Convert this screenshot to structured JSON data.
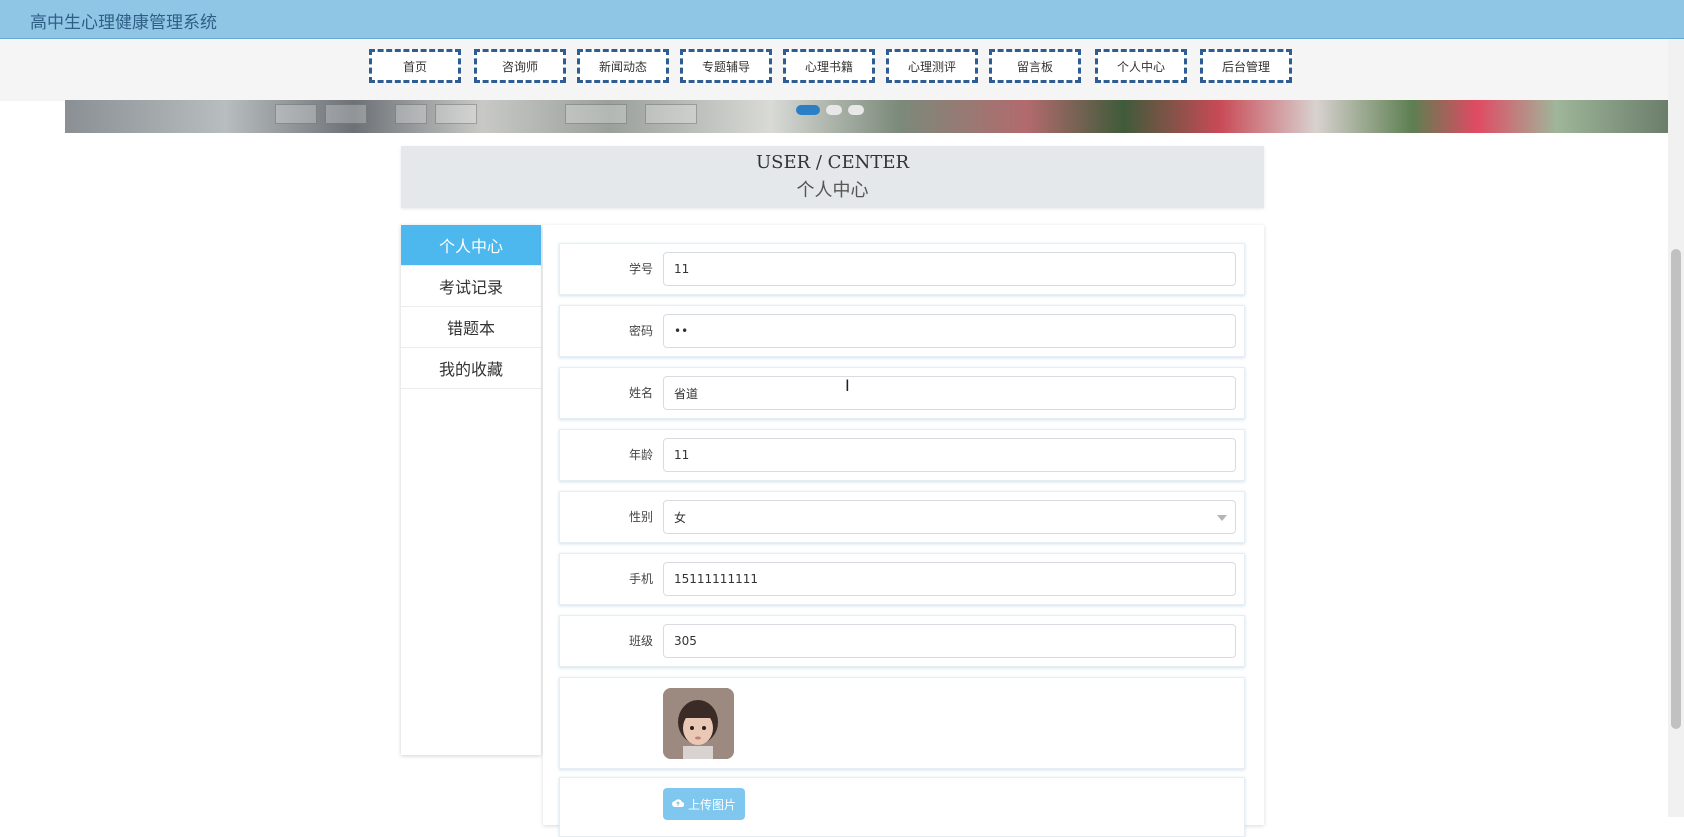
{
  "app": {
    "title": "高中生心理健康管理系统"
  },
  "nav": {
    "items": [
      {
        "label": "首页"
      },
      {
        "label": "咨询师"
      },
      {
        "label": "新闻动态"
      },
      {
        "label": "专题辅导"
      },
      {
        "label": "心理书籍"
      },
      {
        "label": "心理测评"
      },
      {
        "label": "留言板"
      },
      {
        "label": "个人中心"
      },
      {
        "label": "后台管理"
      }
    ]
  },
  "carousel": {
    "active_index": 0,
    "dot_count": 3
  },
  "page_head": {
    "en": "USER / CENTER",
    "cn": "个人中心"
  },
  "sidebar": {
    "items": [
      {
        "label": "个人中心",
        "active": true
      },
      {
        "label": "考试记录"
      },
      {
        "label": "错题本"
      },
      {
        "label": "我的收藏"
      }
    ]
  },
  "form": {
    "student_id": {
      "label": "学号",
      "value": "11"
    },
    "password": {
      "label": "密码",
      "value": "••"
    },
    "name": {
      "label": "姓名",
      "value": "省道"
    },
    "age": {
      "label": "年龄",
      "value": "11"
    },
    "gender": {
      "label": "性别",
      "value": "女"
    },
    "phone": {
      "label": "手机",
      "value": "15111111111"
    },
    "class": {
      "label": "班级",
      "value": "305"
    },
    "upload_label": "上传图片"
  },
  "colors": {
    "topbar": "#8fc6e6",
    "accent": "#4db8ee",
    "nav_border": "#2d5d92"
  }
}
